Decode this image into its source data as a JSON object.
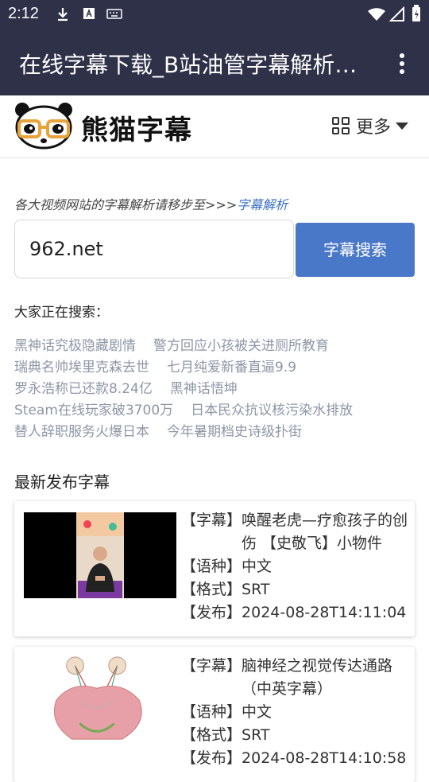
{
  "status_bar": {
    "time": "2:12"
  },
  "app_bar": {
    "title": "在线字幕下载_B站油管字幕解析…"
  },
  "header": {
    "logo_text": "熊猫字幕",
    "more_label": "更多"
  },
  "hint": {
    "text": "各大视频网站的字幕解析请移步至>>>",
    "link": "字幕解析"
  },
  "search": {
    "value": "962.net",
    "button": "字幕搜索"
  },
  "hot": {
    "title": "大家正在搜索：",
    "rows": [
      [
        "黑神话究极隐藏剧情",
        "警方回应小孩被关进厕所教育"
      ],
      [
        "瑞典名帅埃里克森去世",
        "七月纯爱新番直逼9.9"
      ],
      [
        "罗永浩称已还款8.24亿",
        "黑神话悟坤"
      ],
      [
        "Steam在线玩家破3700万",
        "日本民众抗议核污染水排放"
      ],
      [
        "替人辞职服务火爆日本",
        "今年暑期档史诗级扑街"
      ]
    ]
  },
  "latest": {
    "title": "最新发布字幕",
    "labels": {
      "subtitle": "【字幕】",
      "lang": "【语种】",
      "format": "【格式】",
      "date": "【发布】"
    },
    "items": [
      {
        "title": "唤醒老虎—疗愈孩子的创伤 【史敬飞】小物件",
        "lang": "中文",
        "format": "SRT",
        "date": "2024-08-28T14:11:04",
        "thumb": "video-person"
      },
      {
        "title": "脑神经之视觉传达通路（中英字幕）",
        "lang": "中文",
        "format": "SRT",
        "date": "2024-08-28T14:10:58",
        "thumb": "brain-diagram"
      }
    ]
  },
  "colors": {
    "appbar": "#2e3148",
    "accent": "#4a78c8",
    "link": "#3a6fc4",
    "hot_text": "#8e96a6"
  }
}
